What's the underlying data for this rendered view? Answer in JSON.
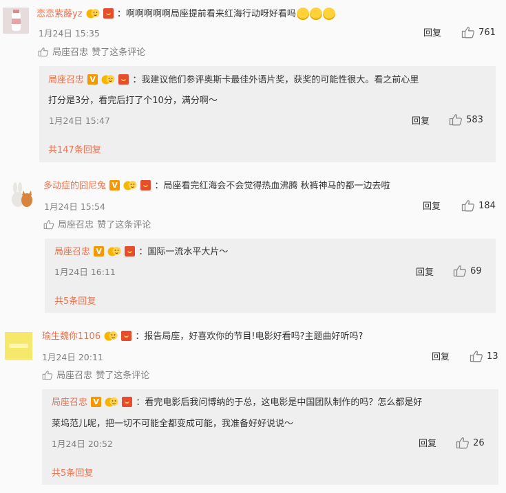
{
  "colors": {
    "username": "#eb7350",
    "text": "#333333",
    "meta": "#808080",
    "reply_bg": "#efefef"
  },
  "comments": [
    {
      "username": "恋恋紫藤yz",
      "text": "啊啊啊啊啊局座提前看来红海行动呀好看吗",
      "time": "1月24日 15:35",
      "reply_label": "回复",
      "likes": "761",
      "liked_by": "局座召忠",
      "liked_suffix": "赞了这条评论",
      "reply": {
        "username": "局座召忠",
        "line1": "我建议他们参评奥斯卡最佳外语片奖，获奖的可能性很大。看之前心里",
        "line2": "打分是3分，看完后打了个10分，满分啊～",
        "time": "1月24日 15:47",
        "reply_label": "回复",
        "likes": "583",
        "more": "共147条回复"
      }
    },
    {
      "username": "多动症的囧尼兔",
      "text": "局座看完红海会不会觉得热血沸腾 秋裤神马的都一边去啦",
      "time": "1月24日 15:54",
      "reply_label": "回复",
      "likes": "184",
      "liked_by": "局座召忠",
      "liked_suffix": "赞了这条评论",
      "reply": {
        "username": "局座召忠",
        "line1": "国际一流水平大片～",
        "time": "1月24日 16:11",
        "reply_label": "回复",
        "likes": "69",
        "more": "共5条回复"
      }
    },
    {
      "username": "瑜生魏你1106",
      "text": "报告局座，好喜欢你的节目!电影好看吗?主题曲好听吗?",
      "time": "1月24日 20:11",
      "reply_label": "回复",
      "likes": "13",
      "liked_by": "局座召忠",
      "liked_suffix": "赞了这条评论",
      "reply": {
        "username": "局座召忠",
        "line1": "看完电影后我问博纳的于总，这电影是中国团队制作的吗？怎么都是好",
        "line2": "莱坞范儿呢，把一切不可能全都变成可能，我准备好好说说～",
        "time": "1月24日 20:52",
        "reply_label": "回复",
        "likes": "26",
        "more": "共5条回复"
      }
    }
  ]
}
